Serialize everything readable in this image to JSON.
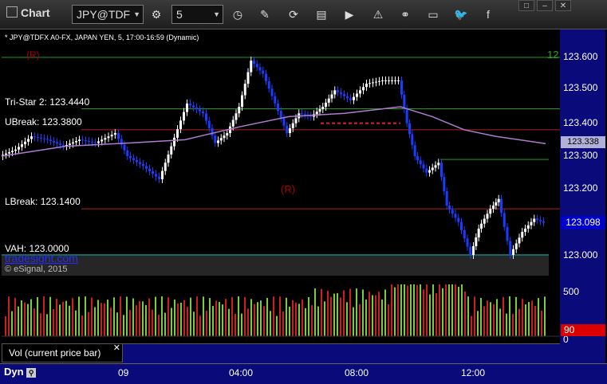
{
  "window": {
    "title": "Chart",
    "controls": [
      "□",
      "–",
      "✕"
    ]
  },
  "toolbar": {
    "symbol": "JPY@TDF",
    "interval": "5"
  },
  "chart": {
    "header": "* JPY@TDFX A0-FX, JAPAN YEN, 5, 17:00-16:59 (Dynamic)",
    "watermark": "tradesight.com",
    "copyright": "© eSignal, 2015",
    "r_marker": "(R)",
    "top_level_mark": "12"
  },
  "levels": [
    {
      "label": "Tri-Star 2: 123.4440",
      "value": 123.444,
      "color": "#22aa22"
    },
    {
      "label": "UBreak: 123.3800",
      "value": 123.38,
      "color": "#cc2222"
    },
    {
      "label": "LBreak: 123.1400",
      "value": 123.14,
      "color": "#cc2222"
    },
    {
      "label": "VAH: 123.0000",
      "value": 123.0,
      "color": "#22cccc"
    }
  ],
  "price_axis": {
    "ticks": [
      "123.600",
      "123.500",
      "123.400",
      "123.300",
      "123.200",
      "123.000"
    ],
    "current_price": "123.098",
    "ma_value": "123.338"
  },
  "volume": {
    "legend": "Vol (current price bar)",
    "ticks": [
      "500",
      "0"
    ],
    "current": "90"
  },
  "time_axis": {
    "label": "Dyn",
    "ticks": [
      "09",
      "04:00",
      "08:00",
      "12:00"
    ]
  },
  "colors": {
    "axis_bg": "#0a0a7a",
    "up": "#ffffff",
    "down": "#1a3cff",
    "ma": "#b07bd0"
  }
}
